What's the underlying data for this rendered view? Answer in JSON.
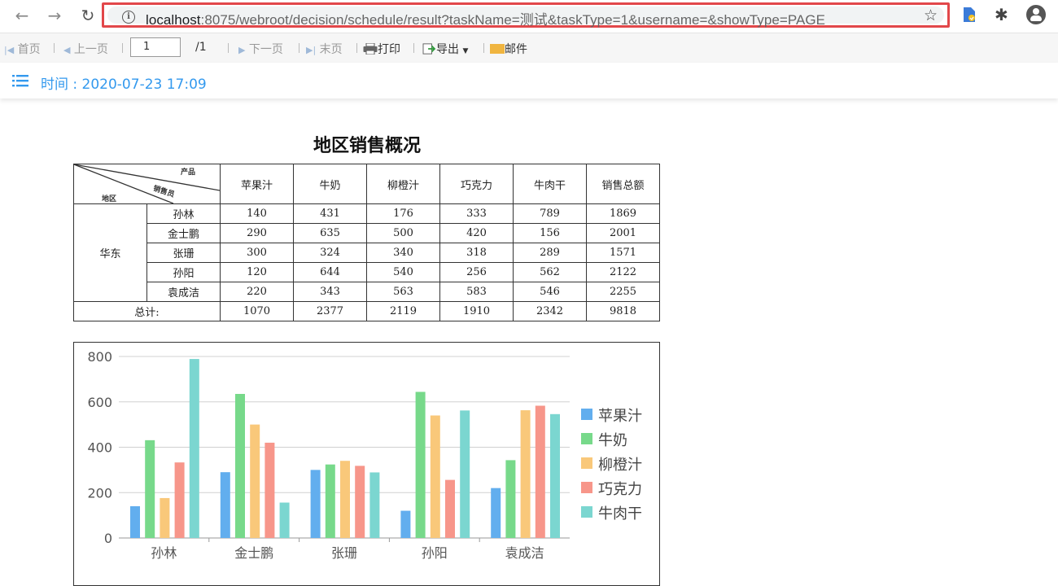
{
  "browser": {
    "url_host": "localhost",
    "url_rest": ":8075/webroot/decision/schedule/result?taskName=测试&taskType=1&username=&showType=PAGE"
  },
  "toolbar": {
    "first": "首页",
    "prev": "上一页",
    "page_value": "1",
    "page_total": "/1",
    "next": "下一页",
    "last": "末页",
    "print": "打印",
    "export": "导出",
    "mail": "邮件"
  },
  "timebar": {
    "text": "时间 : 2020-07-23 17:09"
  },
  "report": {
    "title": "地区销售概况",
    "corner": {
      "product": "产品",
      "salesperson": "销售员",
      "region": "地区"
    },
    "columns": [
      "苹果汁",
      "牛奶",
      "柳橙汁",
      "巧克力",
      "牛肉干",
      "销售总额"
    ],
    "region": "华东",
    "rows": [
      {
        "name": "孙林",
        "values": [
          "140",
          "431",
          "176",
          "333",
          "789",
          "1869"
        ]
      },
      {
        "name": "金士鹏",
        "values": [
          "290",
          "635",
          "500",
          "420",
          "156",
          "2001"
        ]
      },
      {
        "name": "张珊",
        "values": [
          "300",
          "324",
          "340",
          "318",
          "289",
          "1571"
        ]
      },
      {
        "name": "孙阳",
        "values": [
          "120",
          "644",
          "540",
          "256",
          "562",
          "2122"
        ]
      },
      {
        "name": "袁成洁",
        "values": [
          "220",
          "343",
          "563",
          "583",
          "546",
          "2255"
        ]
      }
    ],
    "total_label": "总计:",
    "totals": [
      "1070",
      "2377",
      "2119",
      "1910",
      "2342",
      "9818"
    ]
  },
  "chart_data": {
    "type": "bar",
    "categories": [
      "孙林",
      "金士鹏",
      "张珊",
      "孙阳",
      "袁成洁"
    ],
    "series": [
      {
        "name": "苹果汁",
        "color": "#62aeee",
        "values": [
          140,
          290,
          300,
          120,
          220
        ]
      },
      {
        "name": "牛奶",
        "color": "#77d98a",
        "values": [
          431,
          635,
          324,
          644,
          343
        ]
      },
      {
        "name": "柳橙汁",
        "color": "#f9c87a",
        "values": [
          176,
          500,
          340,
          540,
          563
        ]
      },
      {
        "name": "巧克力",
        "color": "#f7968a",
        "values": [
          333,
          420,
          318,
          256,
          583
        ]
      },
      {
        "name": "牛肉干",
        "color": "#7bd6d0",
        "values": [
          789,
          156,
          289,
          562,
          546
        ]
      }
    ],
    "yticks": [
      0,
      200,
      400,
      600,
      800
    ],
    "ylim": [
      0,
      800
    ],
    "grid": true,
    "legend": "right"
  }
}
